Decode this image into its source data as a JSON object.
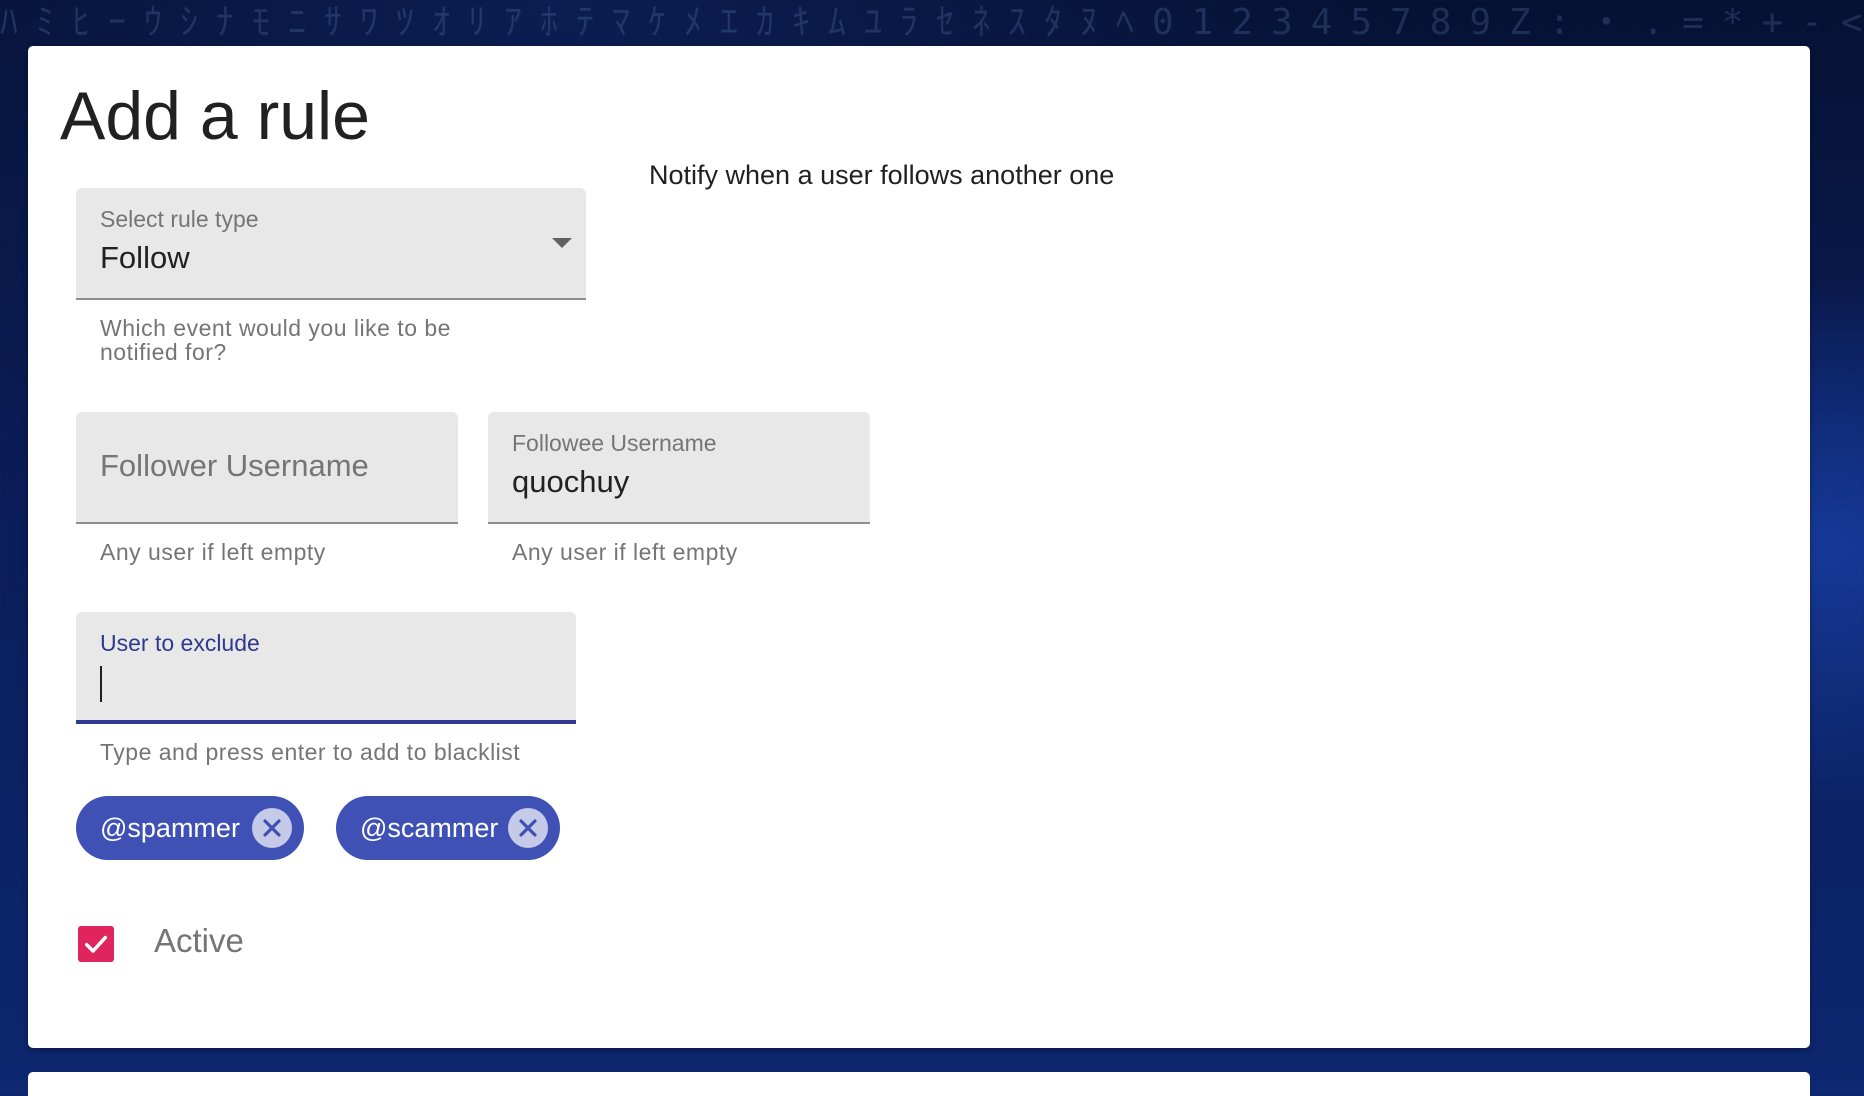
{
  "page": {
    "title": "Add a rule",
    "description": "Notify when a user follows another one"
  },
  "rule_type": {
    "label": "Select rule type",
    "value": "Follow",
    "helper": "Which event would you like to be notified for?"
  },
  "follower": {
    "placeholder": "Follower Username",
    "value": "",
    "helper": "Any user if left empty"
  },
  "followee": {
    "label": "Followee Username",
    "value": "quochuy",
    "helper": "Any user if left empty"
  },
  "exclude": {
    "label": "User to exclude",
    "value": "",
    "helper": "Type and press enter to add to blacklist",
    "chips": [
      "@spammer",
      "@scammer"
    ]
  },
  "active": {
    "label": "Active",
    "checked": true
  },
  "colors": {
    "primary": "#3f51b5",
    "focus": "#2f3a8f",
    "checkbox": "#e0245e"
  },
  "icons": [
    "dropdown-arrow-icon",
    "close-icon",
    "checkmark-icon"
  ]
}
